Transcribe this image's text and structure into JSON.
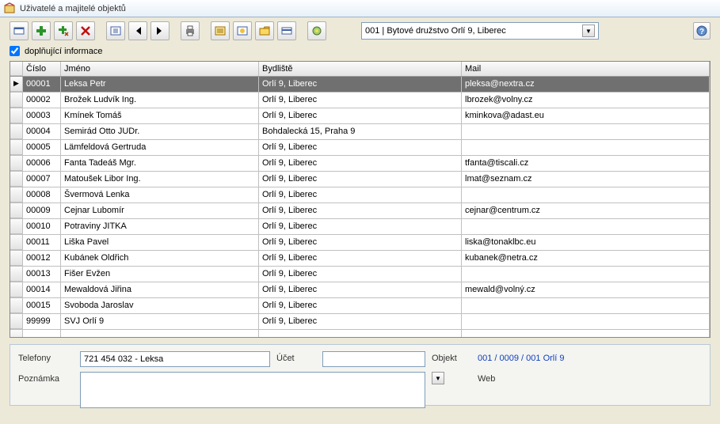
{
  "window": {
    "title": "Uživatelé a majitelé objektů"
  },
  "toolbar": {
    "dropdown": "001 | Bytové družstvo Orlí 9, Liberec"
  },
  "checkbox": {
    "label": "doplňující informace",
    "checked": true
  },
  "grid": {
    "headers": {
      "num": "Číslo",
      "name": "Jméno",
      "addr": "Bydliště",
      "mail": "Mail"
    },
    "rows": [
      {
        "ind": "▶",
        "num": "00001",
        "name": "Leksa Petr",
        "addr": "Orlí 9, Liberec",
        "mail": "pleksa@nextra.cz",
        "selected": true
      },
      {
        "ind": "",
        "num": "00002",
        "name": "Brožek Ludvík Ing.",
        "addr": "Orlí 9, Liberec",
        "mail": "lbrozek@volny.cz"
      },
      {
        "ind": "",
        "num": "00003",
        "name": "Kmínek Tomáš",
        "addr": "Orlí 9, Liberec",
        "mail": "kminkova@adast.eu"
      },
      {
        "ind": "",
        "num": "00004",
        "name": "Semirád Otto JUDr.",
        "addr": "Bohdalecká 15, Praha 9",
        "mail": ""
      },
      {
        "ind": "",
        "num": "00005",
        "name": "Lämfeldová Gertruda",
        "addr": "Orlí 9, Liberec",
        "mail": ""
      },
      {
        "ind": "",
        "num": "00006",
        "name": "Fanta Tadeáš Mgr.",
        "addr": "Orlí 9, Liberec",
        "mail": "tfanta@tiscali.cz"
      },
      {
        "ind": "",
        "num": "00007",
        "name": "Matoušek Libor Ing.",
        "addr": "Orlí 9, Liberec",
        "mail": "lmat@seznam.cz"
      },
      {
        "ind": "",
        "num": "00008",
        "name": "Švermová Lenka",
        "addr": "Orlí 9, Liberec",
        "mail": ""
      },
      {
        "ind": "",
        "num": "00009",
        "name": "Cejnar Lubomír",
        "addr": "Orlí 9, Liberec",
        "mail": "cejnar@centrum.cz"
      },
      {
        "ind": "",
        "num": "00010",
        "name": "Potraviny JITKA",
        "addr": "Orlí 9, Liberec",
        "mail": ""
      },
      {
        "ind": "",
        "num": "00011",
        "name": "Liška Pavel",
        "addr": "Orlí 9, Liberec",
        "mail": "liska@tonaklbc.eu"
      },
      {
        "ind": "",
        "num": "00012",
        "name": "Kubánek Oldřich",
        "addr": "Orlí 9, Liberec",
        "mail": "kubanek@netra.cz"
      },
      {
        "ind": "",
        "num": "00013",
        "name": "Fišer Evžen",
        "addr": "Orlí 9, Liberec",
        "mail": ""
      },
      {
        "ind": "",
        "num": "00014",
        "name": "Mewaldová Jiřina",
        "addr": "Orlí 9, Liberec",
        "mail": "mewald@volný.cz"
      },
      {
        "ind": "",
        "num": "00015",
        "name": "Svoboda Jaroslav",
        "addr": "Orlí 9, Liberec",
        "mail": ""
      },
      {
        "ind": "",
        "num": "99999",
        "name": "SVJ Orlí 9",
        "addr": "Orlí 9, Liberec",
        "mail": ""
      },
      {
        "ind": "",
        "num": "",
        "name": "",
        "addr": "",
        "mail": ""
      }
    ]
  },
  "detail": {
    "labels": {
      "phone": "Telefony",
      "account": "Účet",
      "object": "Objekt",
      "note": "Poznámka",
      "web": "Web"
    },
    "phone": "721 454 032 - Leksa",
    "account": "",
    "object_link": "001 / 0009 / 001   Orlí 9",
    "note": "",
    "web": ""
  }
}
